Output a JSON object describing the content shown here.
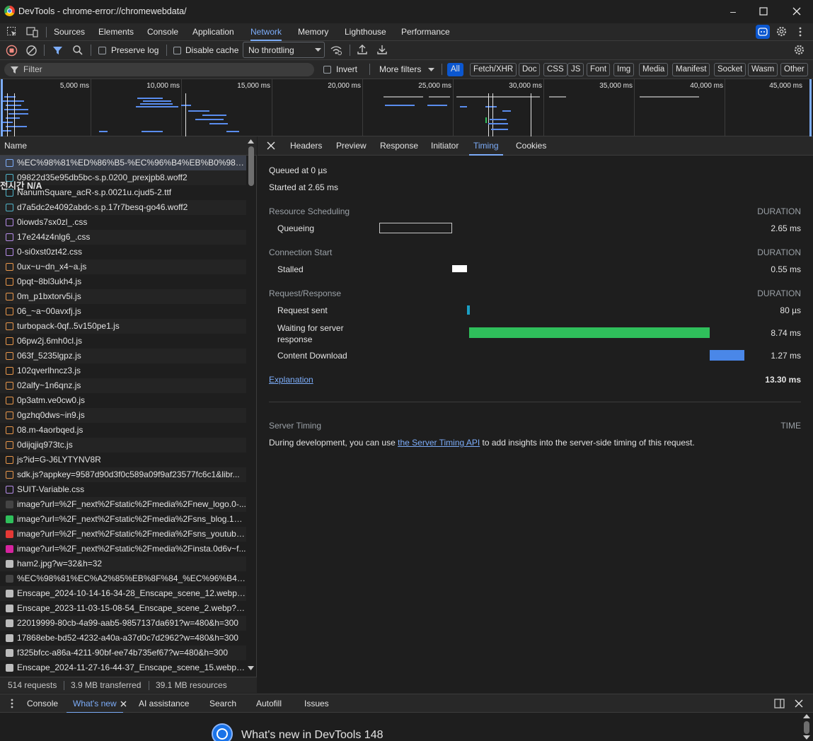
{
  "window": {
    "title": "DevTools - chrome-error://chromewebdata/"
  },
  "tabs": [
    "Sources",
    "Elements",
    "Console",
    "Application",
    "Network",
    "Memory",
    "Lighthouse",
    "Performance"
  ],
  "active_tab": "Network",
  "toolbar": {
    "preserve_log": "Preserve log",
    "disable_cache": "Disable cache",
    "throttling": "No throttling"
  },
  "filter": {
    "placeholder": "Filter",
    "invert": "Invert",
    "more_filters": "More filters",
    "types": [
      "All",
      "Fetch/XHR",
      "Doc",
      "CSS",
      "JS",
      "Font",
      "Img",
      "Media",
      "Manifest",
      "Socket",
      "Wasm",
      "Other"
    ]
  },
  "timeline": {
    "labels": [
      "5,000 ms",
      "10,000 ms",
      "15,000 ms",
      "20,000 ms",
      "25,000 ms",
      "30,000 ms",
      "35,000 ms",
      "40,000 ms",
      "45,000 ms"
    ]
  },
  "requests": {
    "header": "Name",
    "overlay_text": "전시간  N/A",
    "rows": [
      {
        "name": "%EC%98%81%ED%86%B5-%EC%96%B4%EB%B0%98%E...",
        "type": "doc"
      },
      {
        "name": "09822d35e95db5bc-s.p.0200_prexjpb8.woff2",
        "type": "font"
      },
      {
        "name": "NanumSquare_acR-s.p.0021u.cjud5-2.ttf",
        "type": "font"
      },
      {
        "name": "d7a5dc2e4092abdc-s.p.17r7besq-go46.woff2",
        "type": "font"
      },
      {
        "name": "0iowds7sx0zl_.css",
        "type": "css"
      },
      {
        "name": "17e244z4nlg6_.css",
        "type": "css"
      },
      {
        "name": "0-si0xst0zt42.css",
        "type": "css"
      },
      {
        "name": "0ux~u~dn_x4~a.js",
        "type": "js"
      },
      {
        "name": "0pqt~8bl3ukh4.js",
        "type": "js"
      },
      {
        "name": "0m_p1bxtorv5i.js",
        "type": "js"
      },
      {
        "name": "06_~a~00avxfj.js",
        "type": "js"
      },
      {
        "name": "turbopack-0qf..5v150pe1.js",
        "type": "js"
      },
      {
        "name": "06pw2j.6mh0cl.js",
        "type": "js"
      },
      {
        "name": "063f_5235lgpz.js",
        "type": "js"
      },
      {
        "name": "102qverlhncz3.js",
        "type": "js"
      },
      {
        "name": "02alfy~1n6qnz.js",
        "type": "js"
      },
      {
        "name": "0p3atm.ve0cw0.js",
        "type": "js"
      },
      {
        "name": "0gzhq0dws~in9.js",
        "type": "js"
      },
      {
        "name": "08.m-4aorbqed.js",
        "type": "js"
      },
      {
        "name": "0dijqjiq973tc.js",
        "type": "js"
      },
      {
        "name": "js?id=G-J6LYTYNV8R",
        "type": "js"
      },
      {
        "name": "sdk.js?appkey=9587d90d3f0c589a09f9af23577fc6c1&libr...",
        "type": "js"
      },
      {
        "name": "SUIT-Variable.css",
        "type": "css"
      },
      {
        "name": "image?url=%2F_next%2Fstatic%2Fmedia%2Fnew_logo.0-...",
        "type": "img-dark"
      },
      {
        "name": "image?url=%2F_next%2Fstatic%2Fmedia%2Fsns_blog.14r...",
        "type": "img-green"
      },
      {
        "name": "image?url=%2F_next%2Fstatic%2Fmedia%2Fsns_youtube...",
        "type": "img-red"
      },
      {
        "name": "image?url=%2F_next%2Fstatic%2Fmedia%2Finsta.0d6v~f...",
        "type": "img-insta"
      },
      {
        "name": "ham2.jpg?w=32&h=32",
        "type": "img"
      },
      {
        "name": "%EC%98%81%EC%A2%85%EB%8F%84_%EC%96%B4%EB...",
        "type": "img-dark"
      },
      {
        "name": "Enscape_2024-10-14-16-34-28_Enscape_scene_12.webp?...",
        "type": "img"
      },
      {
        "name": "Enscape_2023-11-03-15-08-54_Enscape_scene_2.webp?w...",
        "type": "img"
      },
      {
        "name": "22019999-80cb-4a99-aab5-9857137da691?w=480&h=300",
        "type": "img"
      },
      {
        "name": "17868ebe-bd52-4232-a40a-a37d0c7d2962?w=480&h=300",
        "type": "img"
      },
      {
        "name": "f325bfcc-a86a-4211-90bf-ee74b735ef67?w=480&h=300",
        "type": "img"
      },
      {
        "name": "Enscape_2024-11-27-16-44-37_Enscape_scene_15.webp?...",
        "type": "img"
      }
    ]
  },
  "status": {
    "requests": "514 requests",
    "transferred": "3.9 MB transferred",
    "resources": "39.1 MB resources"
  },
  "detail_tabs": [
    "Headers",
    "Preview",
    "Response",
    "Initiator",
    "Timing",
    "Cookies"
  ],
  "detail_active": "Timing",
  "timing": {
    "queued": "Queued at 0 µs",
    "started": "Started at 2.65 ms",
    "duration_label": "DURATION",
    "sections": [
      {
        "title": "Resource Scheduling",
        "rows": [
          {
            "label": "Queueing",
            "value": "2.65 ms"
          }
        ]
      },
      {
        "title": "Connection Start",
        "rows": [
          {
            "label": "Stalled",
            "value": "0.55 ms"
          }
        ]
      },
      {
        "title": "Request/Response",
        "rows": [
          {
            "label": "Request sent",
            "value": "80 µs"
          },
          {
            "label": "Waiting for server response",
            "value": "8.74 ms"
          },
          {
            "label": "Content Download",
            "value": "1.27 ms"
          }
        ]
      }
    ],
    "explanation": "Explanation",
    "total": "13.30 ms",
    "server_timing": {
      "title": "Server Timing",
      "time_label": "TIME",
      "text_before": "During development, you can use",
      "link": "the Server Timing API",
      "text_after": "to add insights into the server-side timing of this request."
    },
    "colors": {
      "queueing": "#1e1e1e",
      "stalled": "#ffffff",
      "request_sent": "#1a9fc4",
      "waiting": "#2fbf5b",
      "download": "#4a87e8"
    }
  },
  "drawer": {
    "tabs": [
      "Console",
      "What's new",
      "AI assistance",
      "Search",
      "Autofill",
      "Issues"
    ],
    "active": "What's new",
    "whats_new_title": "What's new in DevTools 148"
  }
}
